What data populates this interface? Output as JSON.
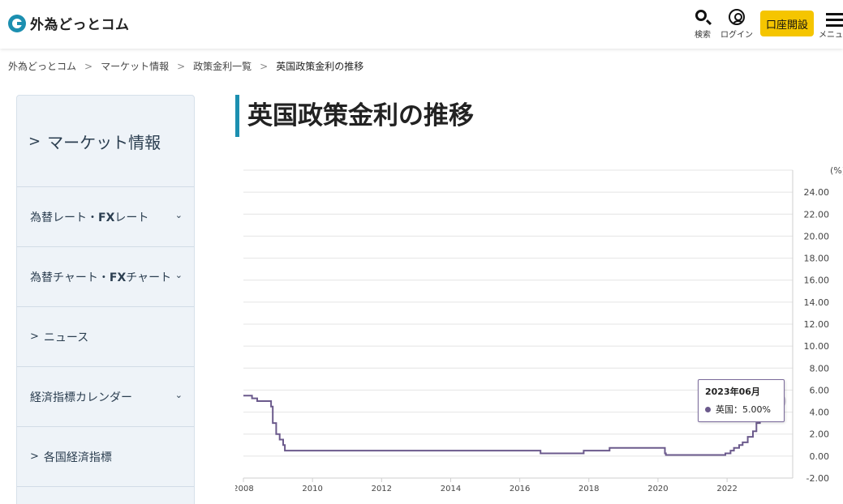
{
  "header": {
    "logo_text": "外為どっとコム",
    "search_label": "検索",
    "login_label": "ログイン",
    "open_account_label": "口座開設",
    "menu_label": "メニュー"
  },
  "breadcrumb": {
    "items": [
      "外為どっとコム",
      "マーケット情報",
      "政策金利一覧"
    ],
    "current": "英国政策金利の推移"
  },
  "sidebar": {
    "heading": "マーケット情報",
    "items": [
      {
        "label_a": "為替レート・",
        "label_b": "FX",
        "label_c": "レート",
        "expandable": true
      },
      {
        "label_a": "為替チャート・",
        "label_b": "FX",
        "label_c": "チャート",
        "expandable": true
      },
      {
        "label": "ニュース",
        "expandable": false
      },
      {
        "label": "経済指標カレンダー",
        "expandable": true
      },
      {
        "label": "各国経済指標",
        "expandable": false
      }
    ]
  },
  "page": {
    "title": "英国政策金利の推移"
  },
  "colors": {
    "accent": "#1c8fb0",
    "series": "#6b5a8c",
    "button": "#f5c500"
  },
  "chart_data": {
    "type": "line",
    "step": true,
    "unit_label": "(%)",
    "y_ticks": [
      "24.00",
      "22.00",
      "20.00",
      "18.00",
      "16.00",
      "14.00",
      "12.00",
      "10.00",
      "8.00",
      "6.00",
      "4.00",
      "2.00",
      "0.00",
      "-2.00"
    ],
    "x_ticks": [
      "2008",
      "2010",
      "2012",
      "2014",
      "2016",
      "2018",
      "2020",
      "2022"
    ],
    "ylim": [
      -2,
      26
    ],
    "xlim": [
      2008.0,
      2023.9
    ],
    "grid": true,
    "series": [
      {
        "name": "英国",
        "points": [
          [
            2008.0,
            5.5
          ],
          [
            2008.25,
            5.25
          ],
          [
            2008.4,
            5.0
          ],
          [
            2008.8,
            4.5
          ],
          [
            2008.85,
            3.0
          ],
          [
            2008.95,
            2.0
          ],
          [
            2009.05,
            1.5
          ],
          [
            2009.15,
            1.0
          ],
          [
            2009.2,
            0.5
          ],
          [
            2016.6,
            0.25
          ],
          [
            2017.85,
            0.5
          ],
          [
            2018.6,
            0.75
          ],
          [
            2020.2,
            0.25
          ],
          [
            2020.23,
            0.1
          ],
          [
            2021.95,
            0.25
          ],
          [
            2022.1,
            0.5
          ],
          [
            2022.2,
            0.75
          ],
          [
            2022.35,
            1.0
          ],
          [
            2022.45,
            1.25
          ],
          [
            2022.6,
            1.75
          ],
          [
            2022.75,
            2.25
          ],
          [
            2022.85,
            3.0
          ],
          [
            2022.95,
            3.5
          ],
          [
            2023.1,
            4.0
          ],
          [
            2023.25,
            4.25
          ],
          [
            2023.4,
            4.5
          ],
          [
            2023.5,
            5.0
          ]
        ]
      }
    ],
    "tooltip": {
      "date": "2023年06月",
      "series_name": "英国",
      "value_text": "英国：5.00%"
    }
  }
}
